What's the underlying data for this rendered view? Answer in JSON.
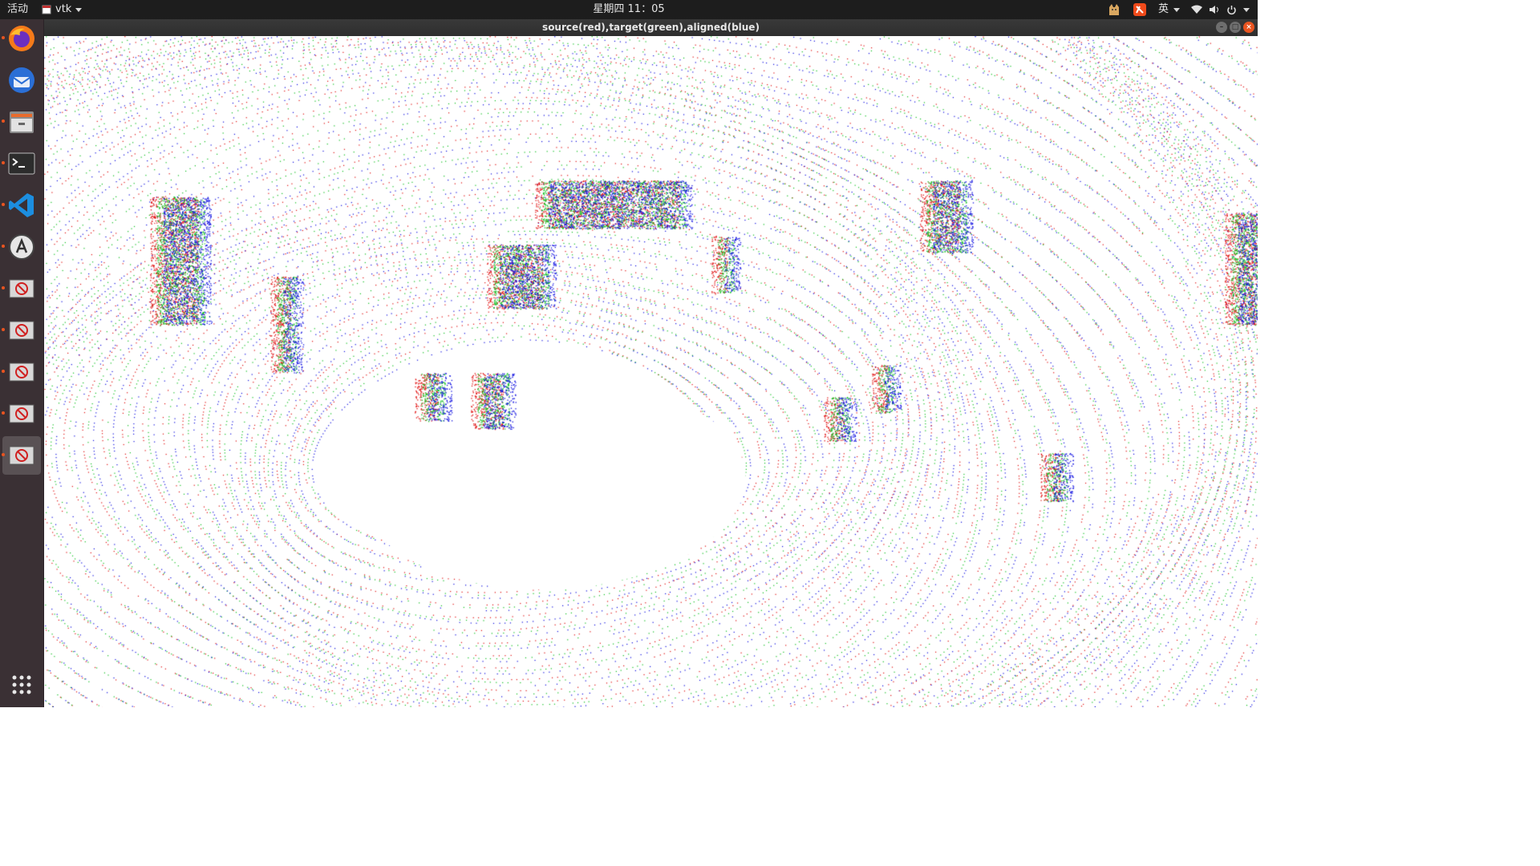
{
  "topbar": {
    "activities": "活动",
    "app_menu_label": "vtk",
    "clock": "星期四 11：05",
    "input_method": "英"
  },
  "window": {
    "title": "source(red),target(green),aligned(blue)"
  },
  "dock": {
    "items": [
      {
        "icon": "firefox-icon",
        "running": true
      },
      {
        "icon": "thunderbird-icon",
        "running": false
      },
      {
        "icon": "files-icon",
        "running": true
      },
      {
        "icon": "terminal-icon",
        "running": true
      },
      {
        "icon": "vscode-icon",
        "running": true
      },
      {
        "icon": "software-updater-icon",
        "running": true
      },
      {
        "icon": "unknown-app-icon",
        "running": true
      },
      {
        "icon": "unknown-app-icon",
        "running": true
      },
      {
        "icon": "unknown-app-icon",
        "running": true
      },
      {
        "icon": "unknown-app-icon",
        "running": true
      },
      {
        "icon": "unknown-app-icon",
        "running": true,
        "active": true
      }
    ],
    "show_apps_icon": "grid-icon"
  },
  "colors": {
    "source": "#e01010",
    "target": "#10c020",
    "aligned": "#1010e0",
    "accent": "#e95420"
  }
}
